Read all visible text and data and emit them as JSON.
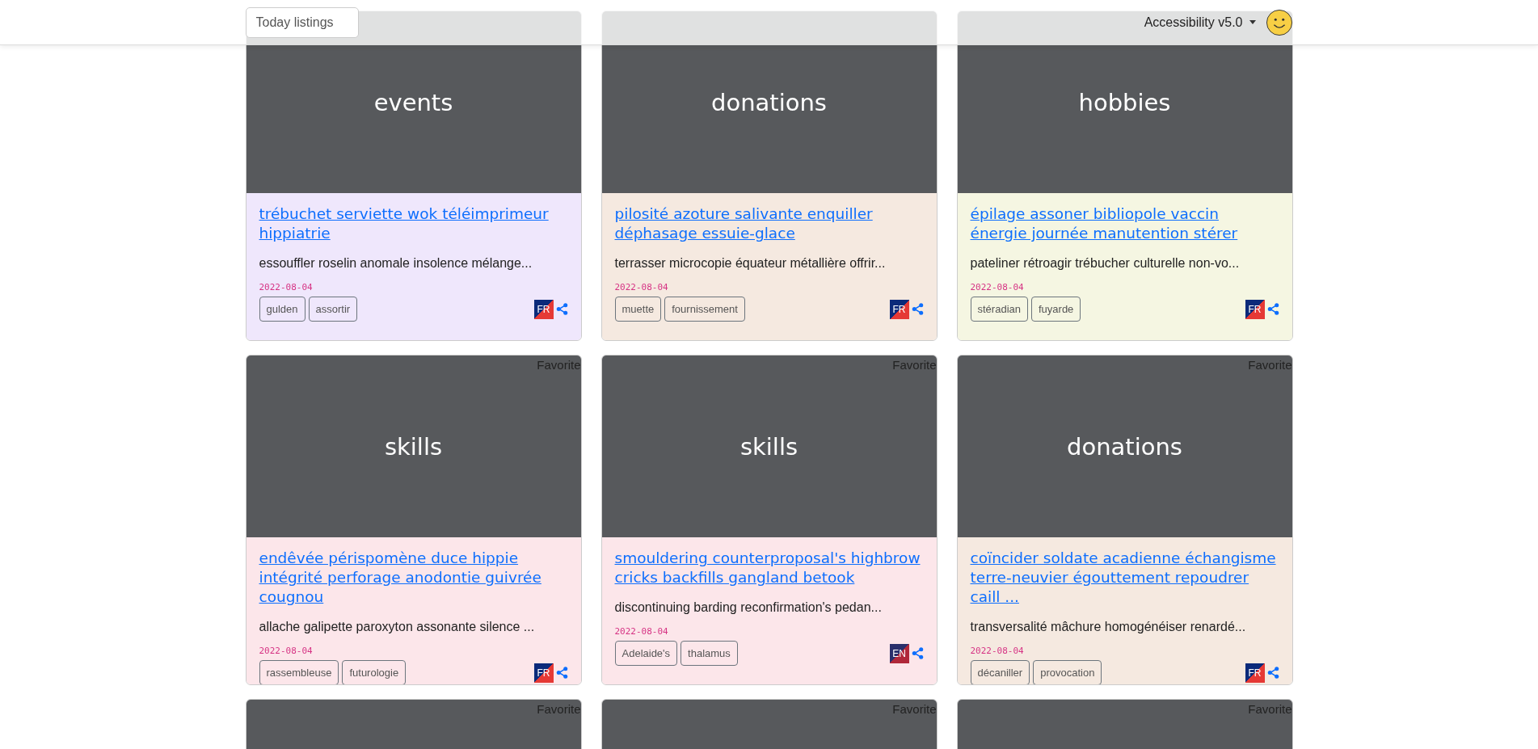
{
  "header": {
    "search": {
      "placeholder": "Today listings"
    },
    "menu": {
      "label": "Accessibility v5.0"
    }
  },
  "cards": [
    {
      "category": "events",
      "title": "trébuchet serviette wok téléimprimeur hippiatrie",
      "description": "essouffler roselin anomale insolence mélange...",
      "date": "2022-08-04",
      "tags": [
        "gulden",
        "assortir"
      ],
      "lang": "FR",
      "color": "#efe7fc"
    },
    {
      "category": "donations",
      "title": "pilosité azoture salivante enquiller déphasage essuie-glace",
      "description": "terrasser microcopie équateur métallière offrir...",
      "date": "2022-08-04",
      "tags": [
        "muette",
        "fournissement"
      ],
      "lang": "FR",
      "color": "#f5e9e0"
    },
    {
      "category": "hobbies",
      "title": "épilage assoner bibliopole vaccin énergie journée manutention stérer",
      "description": "pateliner rétroagir trébucher culturelle non-vo...",
      "date": "2022-08-04",
      "tags": [
        "stéradian",
        "fuyarde"
      ],
      "lang": "FR",
      "color": "#f5f6e2"
    },
    {
      "favorite": "Favorite",
      "category": "skills",
      "title": "endêvée périspomène duce hippie intégrité perforage anodontie guivrée cougnou",
      "description": "allache galipette paroxyton assonante silence ...",
      "date": "2022-08-04",
      "tags": [
        "rassembleuse",
        "futurologie"
      ],
      "lang": "FR",
      "color": "#fce6ea"
    },
    {
      "favorite": "Favorite",
      "category": "skills",
      "title": "smouldering counterproposal's highbrow cricks backfills gangland betook",
      "description": "discontinuing barding reconfirmation's pedan...",
      "date": "2022-08-04",
      "tags": [
        "Adelaide's",
        "thalamus"
      ],
      "lang": "EN",
      "color": "#fce6ea"
    },
    {
      "favorite": "Favorite",
      "category": "donations",
      "title": "coïncider soldate acadienne échangisme terre-neuvier égouttement repoudrer caill ...",
      "description": "transversalité mâchure homogénéiser renardé...",
      "date": "2022-08-04",
      "tags": [
        "décaniller",
        "provocation"
      ],
      "lang": "FR",
      "color": "#f5e9e0"
    },
    {
      "favorite": "Favorite"
    },
    {
      "favorite": "Favorite"
    },
    {
      "favorite": "Favorite"
    }
  ]
}
